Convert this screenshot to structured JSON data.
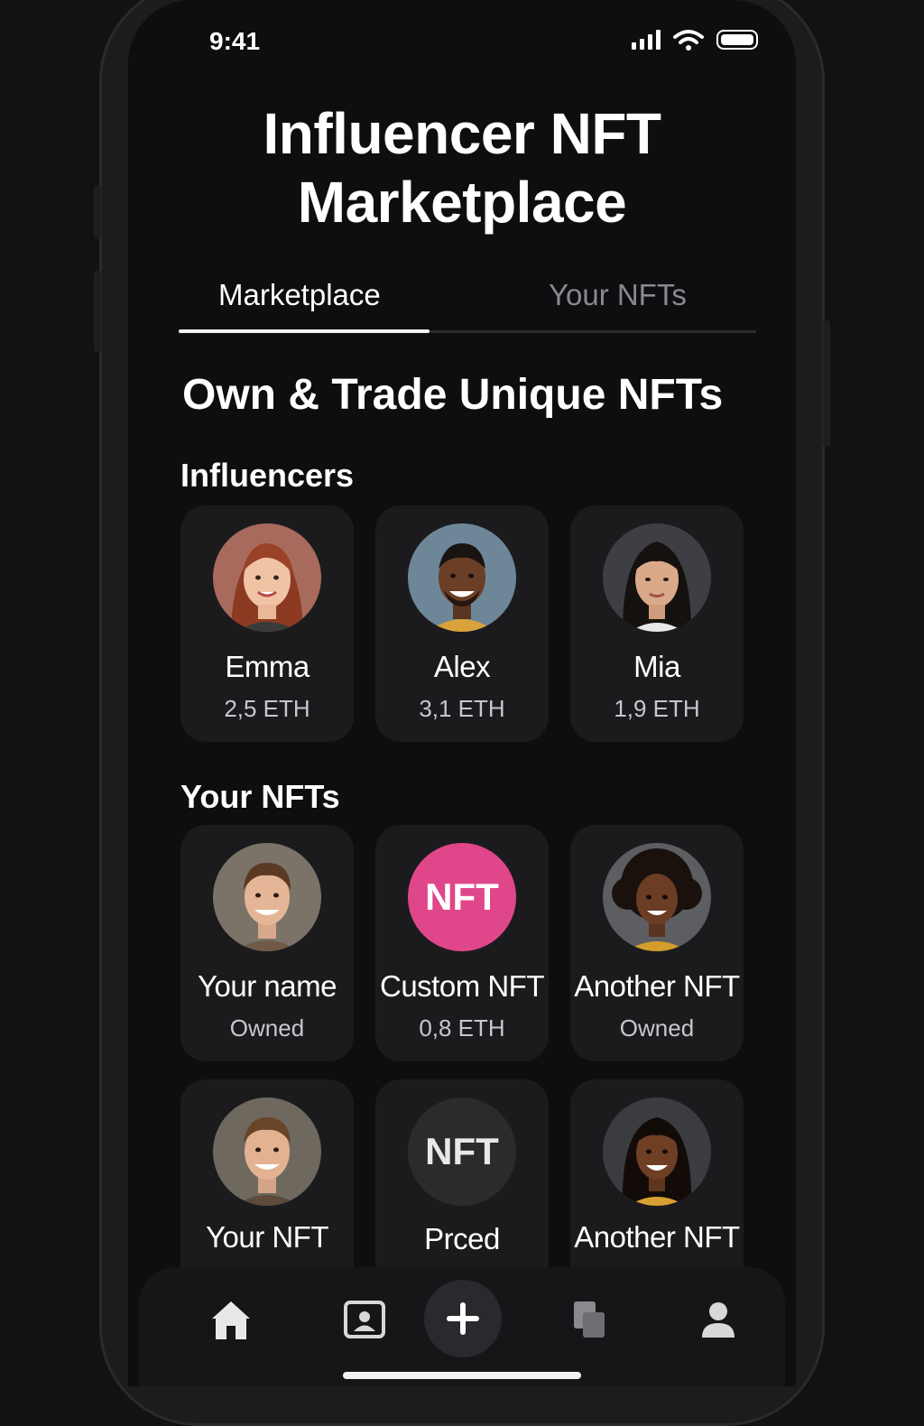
{
  "status": {
    "time": "9:41"
  },
  "header": {
    "title_line1": "Influencer NFT",
    "title_line2": "Marketplace"
  },
  "tabs": [
    {
      "label": "Marketplace",
      "active": true
    },
    {
      "label": "Your NFTs",
      "active": false
    }
  ],
  "headline": "Own & Trade Unique NFTs",
  "influencers": {
    "title": "Influencers",
    "items": [
      {
        "name": "Emma",
        "price": "2,5 ETH"
      },
      {
        "name": "Alex",
        "price": "3,1 ETH"
      },
      {
        "name": "Mia",
        "price": "1,9 ETH"
      }
    ]
  },
  "your_nfts": {
    "title": "Your NFTs",
    "items": [
      {
        "name": "Your name",
        "sub": "Owned"
      },
      {
        "name": "Custom NFT",
        "sub": "0,8 ETH",
        "badge": "NFT"
      },
      {
        "name": "Another NFT",
        "sub": "Owned"
      },
      {
        "name": "Your  NFT",
        "sub": ""
      },
      {
        "name": "Prced",
        "sub": "",
        "badge": "NFT"
      },
      {
        "name": "Another NFT",
        "sub": ""
      }
    ]
  },
  "nav": [
    "home-icon",
    "profile-card-icon",
    "plus-icon",
    "documents-icon",
    "user-icon"
  ],
  "colors": {
    "background": "#0e0e10",
    "card": "#1b1b1e",
    "nft_pink": "#e0468a",
    "nft_gray": "#2b2b2e"
  }
}
